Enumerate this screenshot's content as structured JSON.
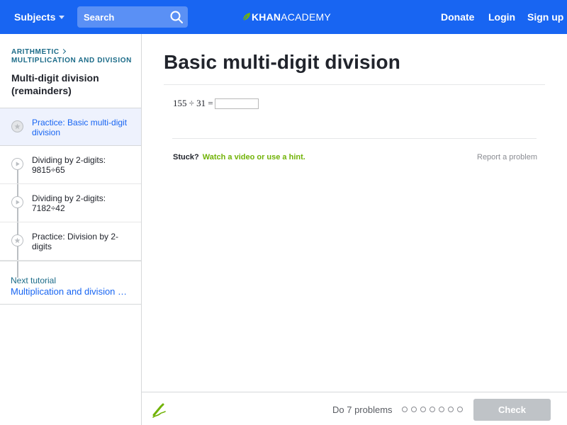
{
  "header": {
    "subjects_label": "Subjects",
    "search_placeholder": "Search",
    "logo_khan": "KHAN",
    "logo_academy": "ACADEMY",
    "donate": "Donate",
    "login": "Login",
    "signup": "Sign up"
  },
  "sidebar": {
    "breadcrumb": [
      "Arithmetic",
      "Multiplication and division"
    ],
    "tutorial_title": "Multi-digit division (remainders)",
    "items": [
      {
        "label": "Practice: Basic multi-digit division",
        "icon": "star-icon",
        "active": true
      },
      {
        "label": "Dividing by 2-digits: 9815÷65",
        "icon": "play-icon",
        "active": false
      },
      {
        "label": "Dividing by 2-digits: 7182÷42",
        "icon": "play-icon",
        "active": false
      },
      {
        "label": "Practice: Division by 2-digits",
        "icon": "star-icon",
        "active": false
      }
    ],
    "next_label": "Next tutorial",
    "next_title": "Multiplication and division word problems"
  },
  "main": {
    "title": "Basic multi-digit division",
    "problem": "155 ÷ 31 =",
    "answer_value": "",
    "stuck_label": "Stuck?",
    "hint_link": "Watch a video or use a hint.",
    "report_link": "Report a problem"
  },
  "footer": {
    "do_problems": "Do 7 problems",
    "problem_count": 7,
    "problems_completed": 0,
    "check_label": "Check"
  },
  "colors": {
    "brand_blue": "#1865f2",
    "hint_green": "#71b307",
    "check_disabled": "#bfc3c7"
  }
}
